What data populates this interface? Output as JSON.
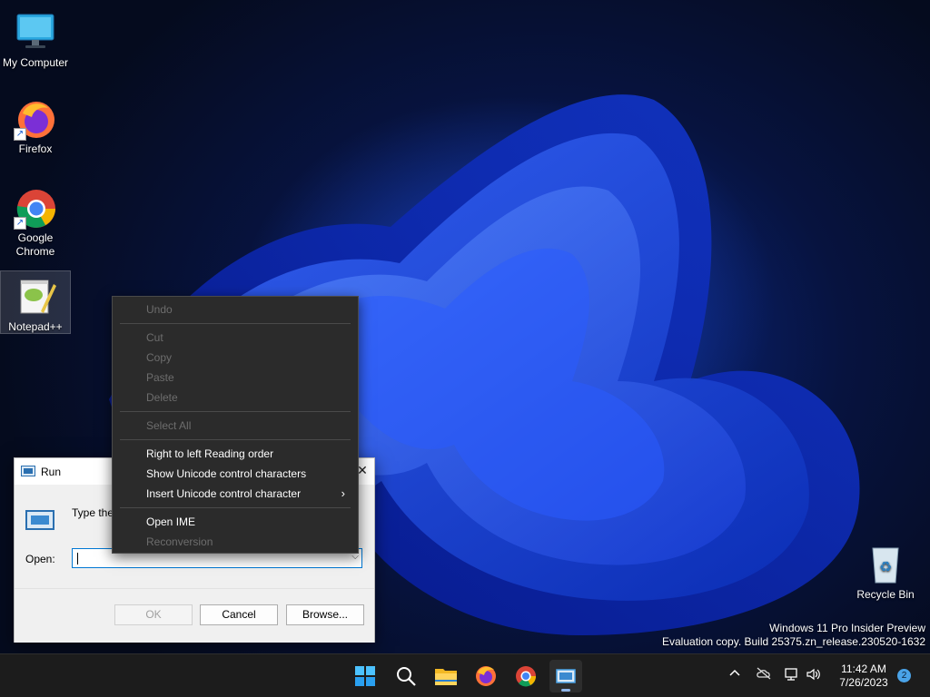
{
  "desktop": {
    "icons": [
      {
        "label": "My Computer"
      },
      {
        "label": "Firefox"
      },
      {
        "label": "Google Chrome"
      },
      {
        "label": "Notepad++"
      },
      {
        "label": "Recycle Bin"
      }
    ],
    "watermark": {
      "line1": "Windows 11 Pro Insider Preview",
      "line2": "Evaluation copy. Build 25375.zn_release.230520-1632"
    }
  },
  "run_dialog": {
    "title": "Run",
    "description": "Type the name of a program, folder, document, or Internet resource, and Windows will open it for you.",
    "open_label": "Open:",
    "input_value": "",
    "buttons": {
      "ok": "OK",
      "cancel": "Cancel",
      "browse": "Browse..."
    },
    "close_glyph": "✕"
  },
  "context_menu": {
    "items": [
      {
        "label": "Undo",
        "enabled": false
      },
      {
        "label": "Cut",
        "enabled": false
      },
      {
        "label": "Copy",
        "enabled": false
      },
      {
        "label": "Paste",
        "enabled": false
      },
      {
        "label": "Delete",
        "enabled": false
      },
      {
        "label": "Select All",
        "enabled": false
      },
      {
        "label": "Right to left Reading order",
        "enabled": true
      },
      {
        "label": "Show Unicode control characters",
        "enabled": true
      },
      {
        "label": "Insert Unicode control character",
        "enabled": true,
        "submenu": true
      },
      {
        "label": "Open IME",
        "enabled": true
      },
      {
        "label": "Reconversion",
        "enabled": false
      }
    ],
    "submenu_glyph": "›"
  },
  "taskbar": {
    "apps": [
      "start-icon",
      "search-icon",
      "file-explorer-icon",
      "firefox-icon",
      "chrome-icon",
      "run-icon"
    ],
    "tray": {
      "chevron": "^",
      "time": "11:42 AM",
      "date": "7/26/2023",
      "notification_count": "2"
    }
  },
  "colors": {
    "accent": "#0078d4",
    "menu_bg": "#2b2b2b",
    "taskbar_bg": "#1c1c1c"
  }
}
